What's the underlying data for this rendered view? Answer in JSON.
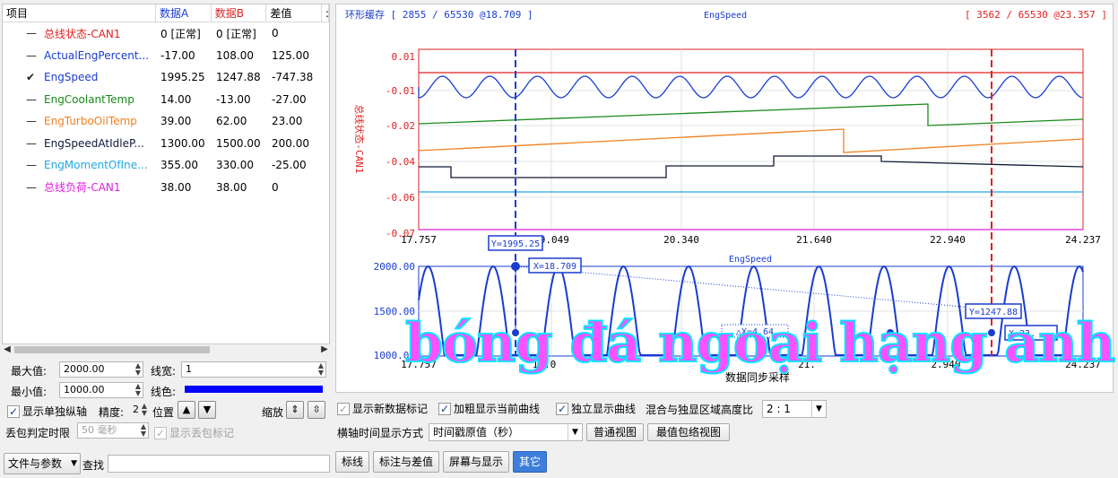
{
  "grid": {
    "headers": {
      "item": "项目",
      "a": "数据A",
      "b": "数据B",
      "diff": "差值"
    },
    "rows": [
      {
        "name": "总线状态-CAN1",
        "a": "0 [正常]",
        "b": "0 [正常]",
        "diff": "0",
        "color": "#e02020",
        "checked": false
      },
      {
        "name": "ActualEngPercent...",
        "a": "-17.00",
        "b": "108.00",
        "diff": "125.00",
        "color": "#1a3cd0",
        "checked": false
      },
      {
        "name": "EngSpeed",
        "a": "1995.25",
        "b": "1247.88",
        "diff": "-747.38",
        "color": "#1a3cd0",
        "checked": true
      },
      {
        "name": "EngCoolantTemp",
        "a": "14.00",
        "b": "-13.00",
        "diff": "-27.00",
        "color": "#1a8a1a",
        "checked": false
      },
      {
        "name": "EngTurboOilTemp",
        "a": "39.00",
        "b": "62.00",
        "diff": "23.00",
        "color": "#f08020",
        "checked": false
      },
      {
        "name": "EngSpeedAtIdleP...",
        "a": "1300.00",
        "b": "1500.00",
        "diff": "200.00",
        "color": "#101838",
        "checked": false
      },
      {
        "name": "EngMomentOfIne...",
        "a": "355.00",
        "b": "330.00",
        "diff": "-25.00",
        "color": "#20a8e0",
        "checked": false
      },
      {
        "name": "总线负荷-CAN1",
        "a": "38.00",
        "b": "38.00",
        "diff": "0",
        "color": "#e020e0",
        "checked": false
      }
    ]
  },
  "props": {
    "max_label": "最大值:",
    "max_value": "2000.00",
    "min_label": "最小值:",
    "min_value": "1000.00",
    "linewidth_label": "线宽:",
    "linewidth_value": "1",
    "linecolor_label": "线色:",
    "linecolor": "#0000ff",
    "show_single_axis": "显示单独纵轴",
    "precision_label": "精度:",
    "precision_value": "2",
    "position_label": "位置",
    "zoom_label": "缩放",
    "drop_label": "丢包判定时限",
    "drop_value": "50 毫秒",
    "show_drop": "显示丢包标记"
  },
  "file_button": "文件与参数",
  "search_label": "查找",
  "chart": {
    "title": "EngSpeed",
    "subtitle": "EngSpeed",
    "ring_cursor_left": "环形缓存 [ 2855 / 65530 @18.709 ]",
    "ring_cursor_right": "[ 3562 / 65530 @23.357 ]",
    "top_y_label": "总线状态-CAN1",
    "top_yticks": [
      "0.01",
      "-0.01",
      "-0.02",
      "-0.04",
      "-0.06",
      "-0.07"
    ],
    "top_xticks": [
      "17.757",
      "19.049",
      "20.340",
      "21.640",
      "22.940",
      "24.237"
    ],
    "bot_yticks": [
      "2000.00",
      "1500.00",
      "1000.00"
    ],
    "bot_xticks": [
      "17.757",
      "19.0",
      "21.",
      "2.940",
      "24.237"
    ],
    "xlabel": "数据同步采样",
    "cursor_a_y": "Y=1995.25",
    "cursor_a_x": "X=18.709",
    "cursor_b_y": "Y=1247.88",
    "cursor_b_x": "X=23.",
    "delta_x": "△X=4.64"
  },
  "options": {
    "show_new_mark": "显示新数据标记",
    "bold_current": "加粗显示当前曲线",
    "solo_curve": "独立显示曲线",
    "ratio_label": "混合与独显区域高度比",
    "ratio_value": "2 : 1",
    "time_label": "横轴时间显示方式",
    "time_value": "时间戳原值（秒）",
    "normal_view": "普通视图",
    "envelope_view": "最值包络视图"
  },
  "tabs": [
    "标线",
    "标注与差值",
    "屏幕与显示",
    "其它"
  ],
  "watermark": "bóng đá ngoại hạng anh"
}
